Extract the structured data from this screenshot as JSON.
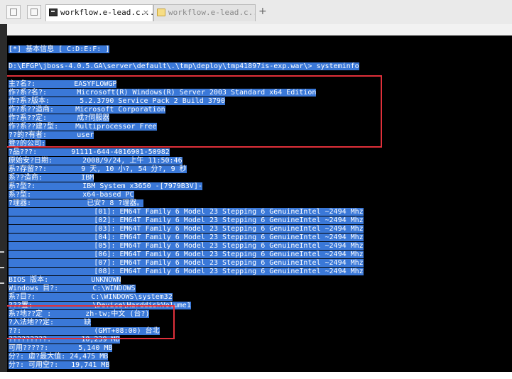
{
  "browser": {
    "tabs": [
      {
        "title": "workflow.e-lead.c...",
        "icon": "terminal-icon",
        "active": true
      },
      {
        "title": "workflow.e-lead.c...",
        "icon": "folder-icon",
        "active": false
      }
    ],
    "new_tab_label": "+",
    "close_label": "×"
  },
  "console": {
    "lines": [
      "[*] 基本信息 [ C:D:E:F: ]",
      "",
      "D:\\EFGP\\jboss-4.0.5.GA\\server\\default\\.\\tmp\\deploy\\tmp41897is-exp.war\\> systeminfo",
      "",
      "",
      "主?名?:         EASYFLOWGP",
      "作?系?名?:       Microsoft(R) Windows(R) Server 2003 Standard x64 Edition",
      "作?系?版本:       5.2.3790 Service Pack 2 Build 3790",
      "作?系??造商:     Microsoft Corporation",
      "作?系??定:       成?伺服器",
      "作?系??建?型:    Multiprocessor Free",
      "??的?有者:       user",
      "登?的公司:",
      "?品???:        91111-644-4016901-50982",
      "原始安?日期:       2008/9/24, 上午 11:50:46",
      "系?存留??:        9 天, 10 小?, 54 分?, 9 秒",
      "系??造商:         IBM",
      "系?型?:           IBM System x3650 -[7979B3V]-",
      "系?型:            x64-based PC",
      "?理器:             已安? 8 ?理器。",
      "                    [01]: EM64T Family 6 Model 23 Stepping 6 GenuineIntel ~2494 Mhz",
      "                    [02]: EM64T Family 6 Model 23 Stepping 6 GenuineIntel ~2494 Mhz",
      "                    [03]: EM64T Family 6 Model 23 Stepping 6 GenuineIntel ~2494 Mhz",
      "                    [04]: EM64T Family 6 Model 23 Stepping 6 GenuineIntel ~2494 Mhz",
      "                    [05]: EM64T Family 6 Model 23 Stepping 6 GenuineIntel ~2494 Mhz",
      "                    [06]: EM64T Family 6 Model 23 Stepping 6 GenuineIntel ~2494 Mhz",
      "                    [07]: EM64T Family 6 Model 23 Stepping 6 GenuineIntel ~2494 Mhz",
      "                    [08]: EM64T Family 6 Model 23 Stepping 6 GenuineIntel ~2494 Mhz",
      "BIOS 版本:          UNKNOWN",
      "Windows 目?:        C:\\WINDOWS",
      "系?目?:             C:\\WINDOWS\\system32",
      "???置:              \\Device\\HarddiskVolume1",
      "系?地??定 :        zh-tw;中文 (台?)",
      "?入法地??定:       缺",
      "??:                 (GMT+08:00) 台北",
      "?????????:       10,239 MB",
      "可用?????:       5,140 MB",
      "分?: 虛?最大值: 24,475 MB",
      "分?: 可用空?:   19,741 MB"
    ]
  },
  "colors": {
    "console_bg": "#000000",
    "selection": "#3a78d8",
    "highlight_box": "#e0303a"
  }
}
